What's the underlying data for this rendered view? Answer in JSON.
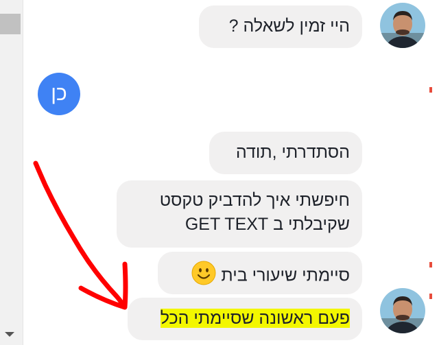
{
  "messages": {
    "incoming_1": "היי זמין לשאלה ?",
    "reply_avatar_letter": "כן",
    "bubble_thanks": "הסתדרתי ,תודה",
    "bubble_search_line1": "חיפשתי איך להדביק טקסט",
    "bubble_search_line2": "שקיבלתי ב GET TEXT",
    "bubble_homework": "סיימתי שיעורי בית",
    "bubble_first_time": "פעם ראשונה שסיימתי הכל"
  },
  "icons": {
    "smile": "smiling-face-emoji",
    "arrow": "red-hand-drawn-arrow",
    "avatar": "user-photo-avatar"
  },
  "colors": {
    "accent_blue": "#3f82f4",
    "bubble_gray": "#f1f0f0",
    "highlight": "#f3f700",
    "arrow_red": "#ff0000"
  }
}
